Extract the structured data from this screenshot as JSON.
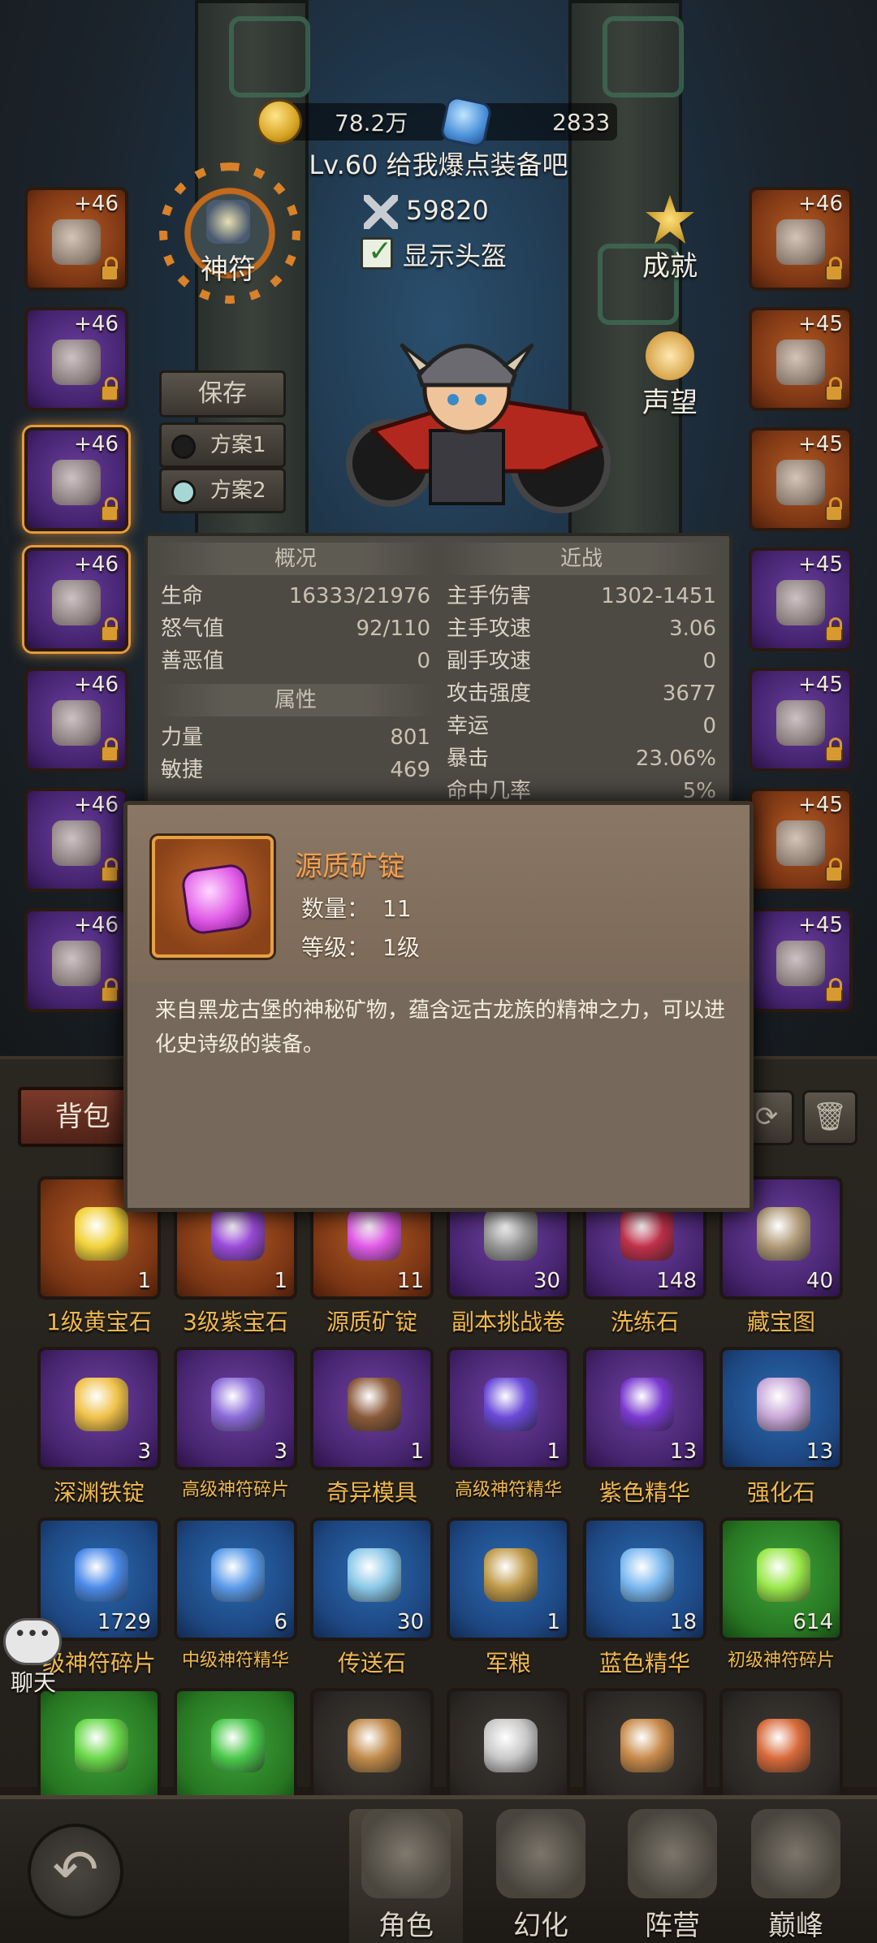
{
  "currency": {
    "gold": "78.2万",
    "gems": "2833"
  },
  "player": {
    "title": "Lv.60 给我爆点装备吧",
    "power": "59820",
    "show_helmet": "显示头盔"
  },
  "side_buttons": {
    "rune": "神符",
    "achievement": "成就",
    "reputation": "声望"
  },
  "loadout": {
    "save": "保存",
    "plan1": "方案1",
    "plan2": "方案2"
  },
  "left_slots": [
    {
      "level": "+46",
      "rarity": "orange",
      "selected": false
    },
    {
      "level": "+46",
      "rarity": "purple",
      "selected": false
    },
    {
      "level": "+46",
      "rarity": "purple",
      "selected": true
    },
    {
      "level": "+46",
      "rarity": "purple",
      "selected": true
    },
    {
      "level": "+46",
      "rarity": "purple",
      "selected": false
    },
    {
      "level": "+46",
      "rarity": "purple",
      "selected": false
    },
    {
      "level": "+46",
      "rarity": "purple",
      "selected": false
    }
  ],
  "right_slots": [
    {
      "level": "+46",
      "rarity": "orange"
    },
    {
      "level": "+45",
      "rarity": "orange"
    },
    {
      "level": "+45",
      "rarity": "orange"
    },
    {
      "level": "+45",
      "rarity": "purple"
    },
    {
      "level": "+45",
      "rarity": "purple"
    },
    {
      "level": "+45",
      "rarity": "orange"
    },
    {
      "level": "+45",
      "rarity": "purple"
    }
  ],
  "stats": {
    "overview_header": "概况",
    "overview": [
      {
        "k": "生命",
        "v": "16333/21976"
      },
      {
        "k": "怒气值",
        "v": "92/110"
      },
      {
        "k": "善恶值",
        "v": "0"
      }
    ],
    "attr_header": "属性",
    "attrs": [
      {
        "k": "力量",
        "v": "801"
      },
      {
        "k": "敏捷",
        "v": "469"
      }
    ],
    "melee_header": "近战",
    "melee": [
      {
        "k": "主手伤害",
        "v": "1302-1451"
      },
      {
        "k": "主手攻速",
        "v": "3.06"
      },
      {
        "k": "副手攻速",
        "v": "0"
      },
      {
        "k": "攻击强度",
        "v": "3677"
      },
      {
        "k": "幸运",
        "v": "0"
      },
      {
        "k": "暴击",
        "v": "23.06%"
      },
      {
        "k": "命中几率",
        "v": "5%"
      }
    ]
  },
  "tooltip": {
    "name": "源质矿锭",
    "qty_label": "数量：",
    "qty": "11",
    "level_label": "等级：",
    "level": "1级",
    "desc": "来自黑龙古堡的神秘矿物，蕴含远古龙族的精神之力，可以进化史诗级的装备。"
  },
  "bag": {
    "tab": "背包",
    "items": [
      {
        "name": "1级黄宝石",
        "count": "1",
        "rarity": "orange",
        "color": "#f2d23a"
      },
      {
        "name": "3级紫宝石",
        "count": "1",
        "rarity": "orange",
        "color": "#9a4ad8"
      },
      {
        "name": "源质矿锭",
        "count": "11",
        "rarity": "orange",
        "color": "#e05ae6"
      },
      {
        "name": "副本挑战卷",
        "count": "30",
        "rarity": "purple",
        "color": "#9a9a9a"
      },
      {
        "name": "洗练石",
        "count": "148",
        "rarity": "purple",
        "color": "#c0304a"
      },
      {
        "name": "藏宝图",
        "count": "40",
        "rarity": "purple",
        "color": "#b09a78"
      },
      {
        "name": "深渊铁锭",
        "count": "3",
        "rarity": "purple",
        "color": "#f0c24a"
      },
      {
        "name": "高级神符碎片",
        "count": "3",
        "rarity": "purple",
        "color": "#8a6ad8"
      },
      {
        "name": "奇异模具",
        "count": "1",
        "rarity": "purple",
        "color": "#8a5a3a"
      },
      {
        "name": "高级神符精华",
        "count": "1",
        "rarity": "purple",
        "color": "#6a4ad8"
      },
      {
        "name": "紫色精华",
        "count": "13",
        "rarity": "purple",
        "color": "#7a3ad0"
      },
      {
        "name": "强化石",
        "count": "13",
        "rarity": "blue",
        "color": "#c8a8d8"
      },
      {
        "name": "级神符碎片",
        "count": "1729",
        "rarity": "blue",
        "color": "#4a8ae8"
      },
      {
        "name": "中级神符精华",
        "count": "6",
        "rarity": "blue",
        "color": "#5a9ae8"
      },
      {
        "name": "传送石",
        "count": "30",
        "rarity": "blue",
        "color": "#8ac8e8"
      },
      {
        "name": "军粮",
        "count": "1",
        "rarity": "blue",
        "color": "#c09a4a"
      },
      {
        "name": "蓝色精华",
        "count": "18",
        "rarity": "blue",
        "color": "#7ab8f0"
      },
      {
        "name": "初级神符碎片",
        "count": "614",
        "rarity": "green",
        "color": "#9ae84a"
      },
      {
        "name": "",
        "count": "",
        "rarity": "green",
        "color": "#6ad84a"
      },
      {
        "name": "",
        "count": "",
        "rarity": "green",
        "color": "#4ac84a"
      },
      {
        "name": "",
        "count": "",
        "rarity": "gray",
        "color": "#c08a4a"
      },
      {
        "name": "",
        "count": "",
        "rarity": "gray",
        "color": "#c8c8c8"
      },
      {
        "name": "",
        "count": "",
        "rarity": "gray",
        "color": "#c88a4a"
      },
      {
        "name": "",
        "count": "",
        "rarity": "gray",
        "color": "#d86a3a"
      }
    ]
  },
  "chat": "聊天",
  "nav": [
    {
      "label": "角色",
      "active": true
    },
    {
      "label": "幻化",
      "active": false
    },
    {
      "label": "阵营",
      "active": false
    },
    {
      "label": "巅峰",
      "active": false
    }
  ]
}
